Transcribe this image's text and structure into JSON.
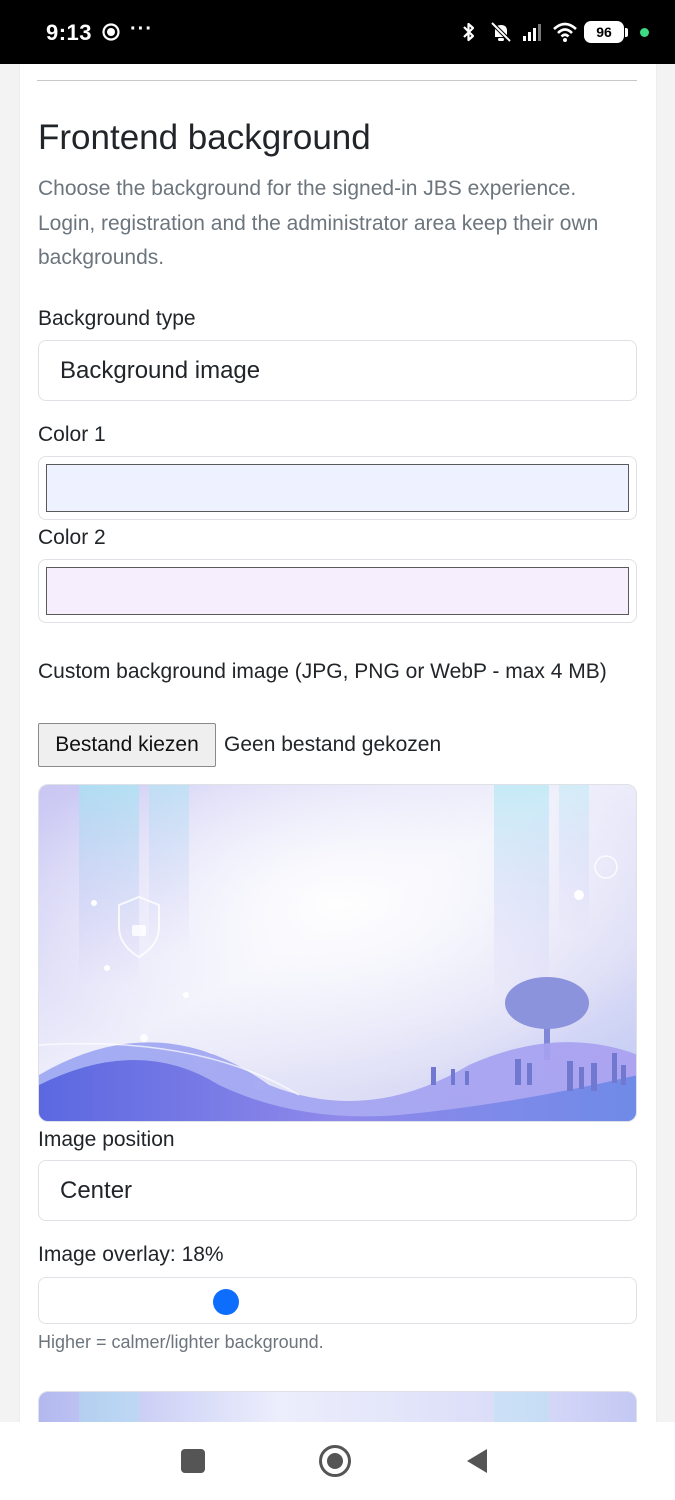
{
  "status_bar": {
    "time": "9:13",
    "notification_dots": "···",
    "battery": "96",
    "icons": [
      "chat-bubble-icon",
      "bluetooth-icon",
      "mute-icon",
      "signal-icon",
      "wifi-icon",
      "battery-icon"
    ]
  },
  "section": {
    "title": "Frontend background",
    "description": "Choose the background for the signed-in JBS experience. Login, registration and the administrator area keep their own backgrounds."
  },
  "form": {
    "background_type_label": "Background type",
    "background_type_value": "Background image",
    "color1_label": "Color 1",
    "color1_value": "#eef1ff",
    "color2_label": "Color 2",
    "color2_value": "#f6edfd",
    "image_label": "Custom background image (JPG, PNG or WebP - max 4 MB)",
    "file_button": "Bestand kiezen",
    "file_status": "Geen bestand gekozen",
    "image_position_label": "Image position",
    "image_position_value": "Center",
    "overlay_label": "Image overlay: 18%",
    "overlay_value": 0.18,
    "overlay_hint": "Higher = calmer/lighter background."
  },
  "colors": {
    "accent": "#0d6efd",
    "muted_text": "#6c757d"
  },
  "nav_bar": {
    "icons": [
      "recents-square-icon",
      "home-circle-icon",
      "back-triangle-icon"
    ]
  }
}
